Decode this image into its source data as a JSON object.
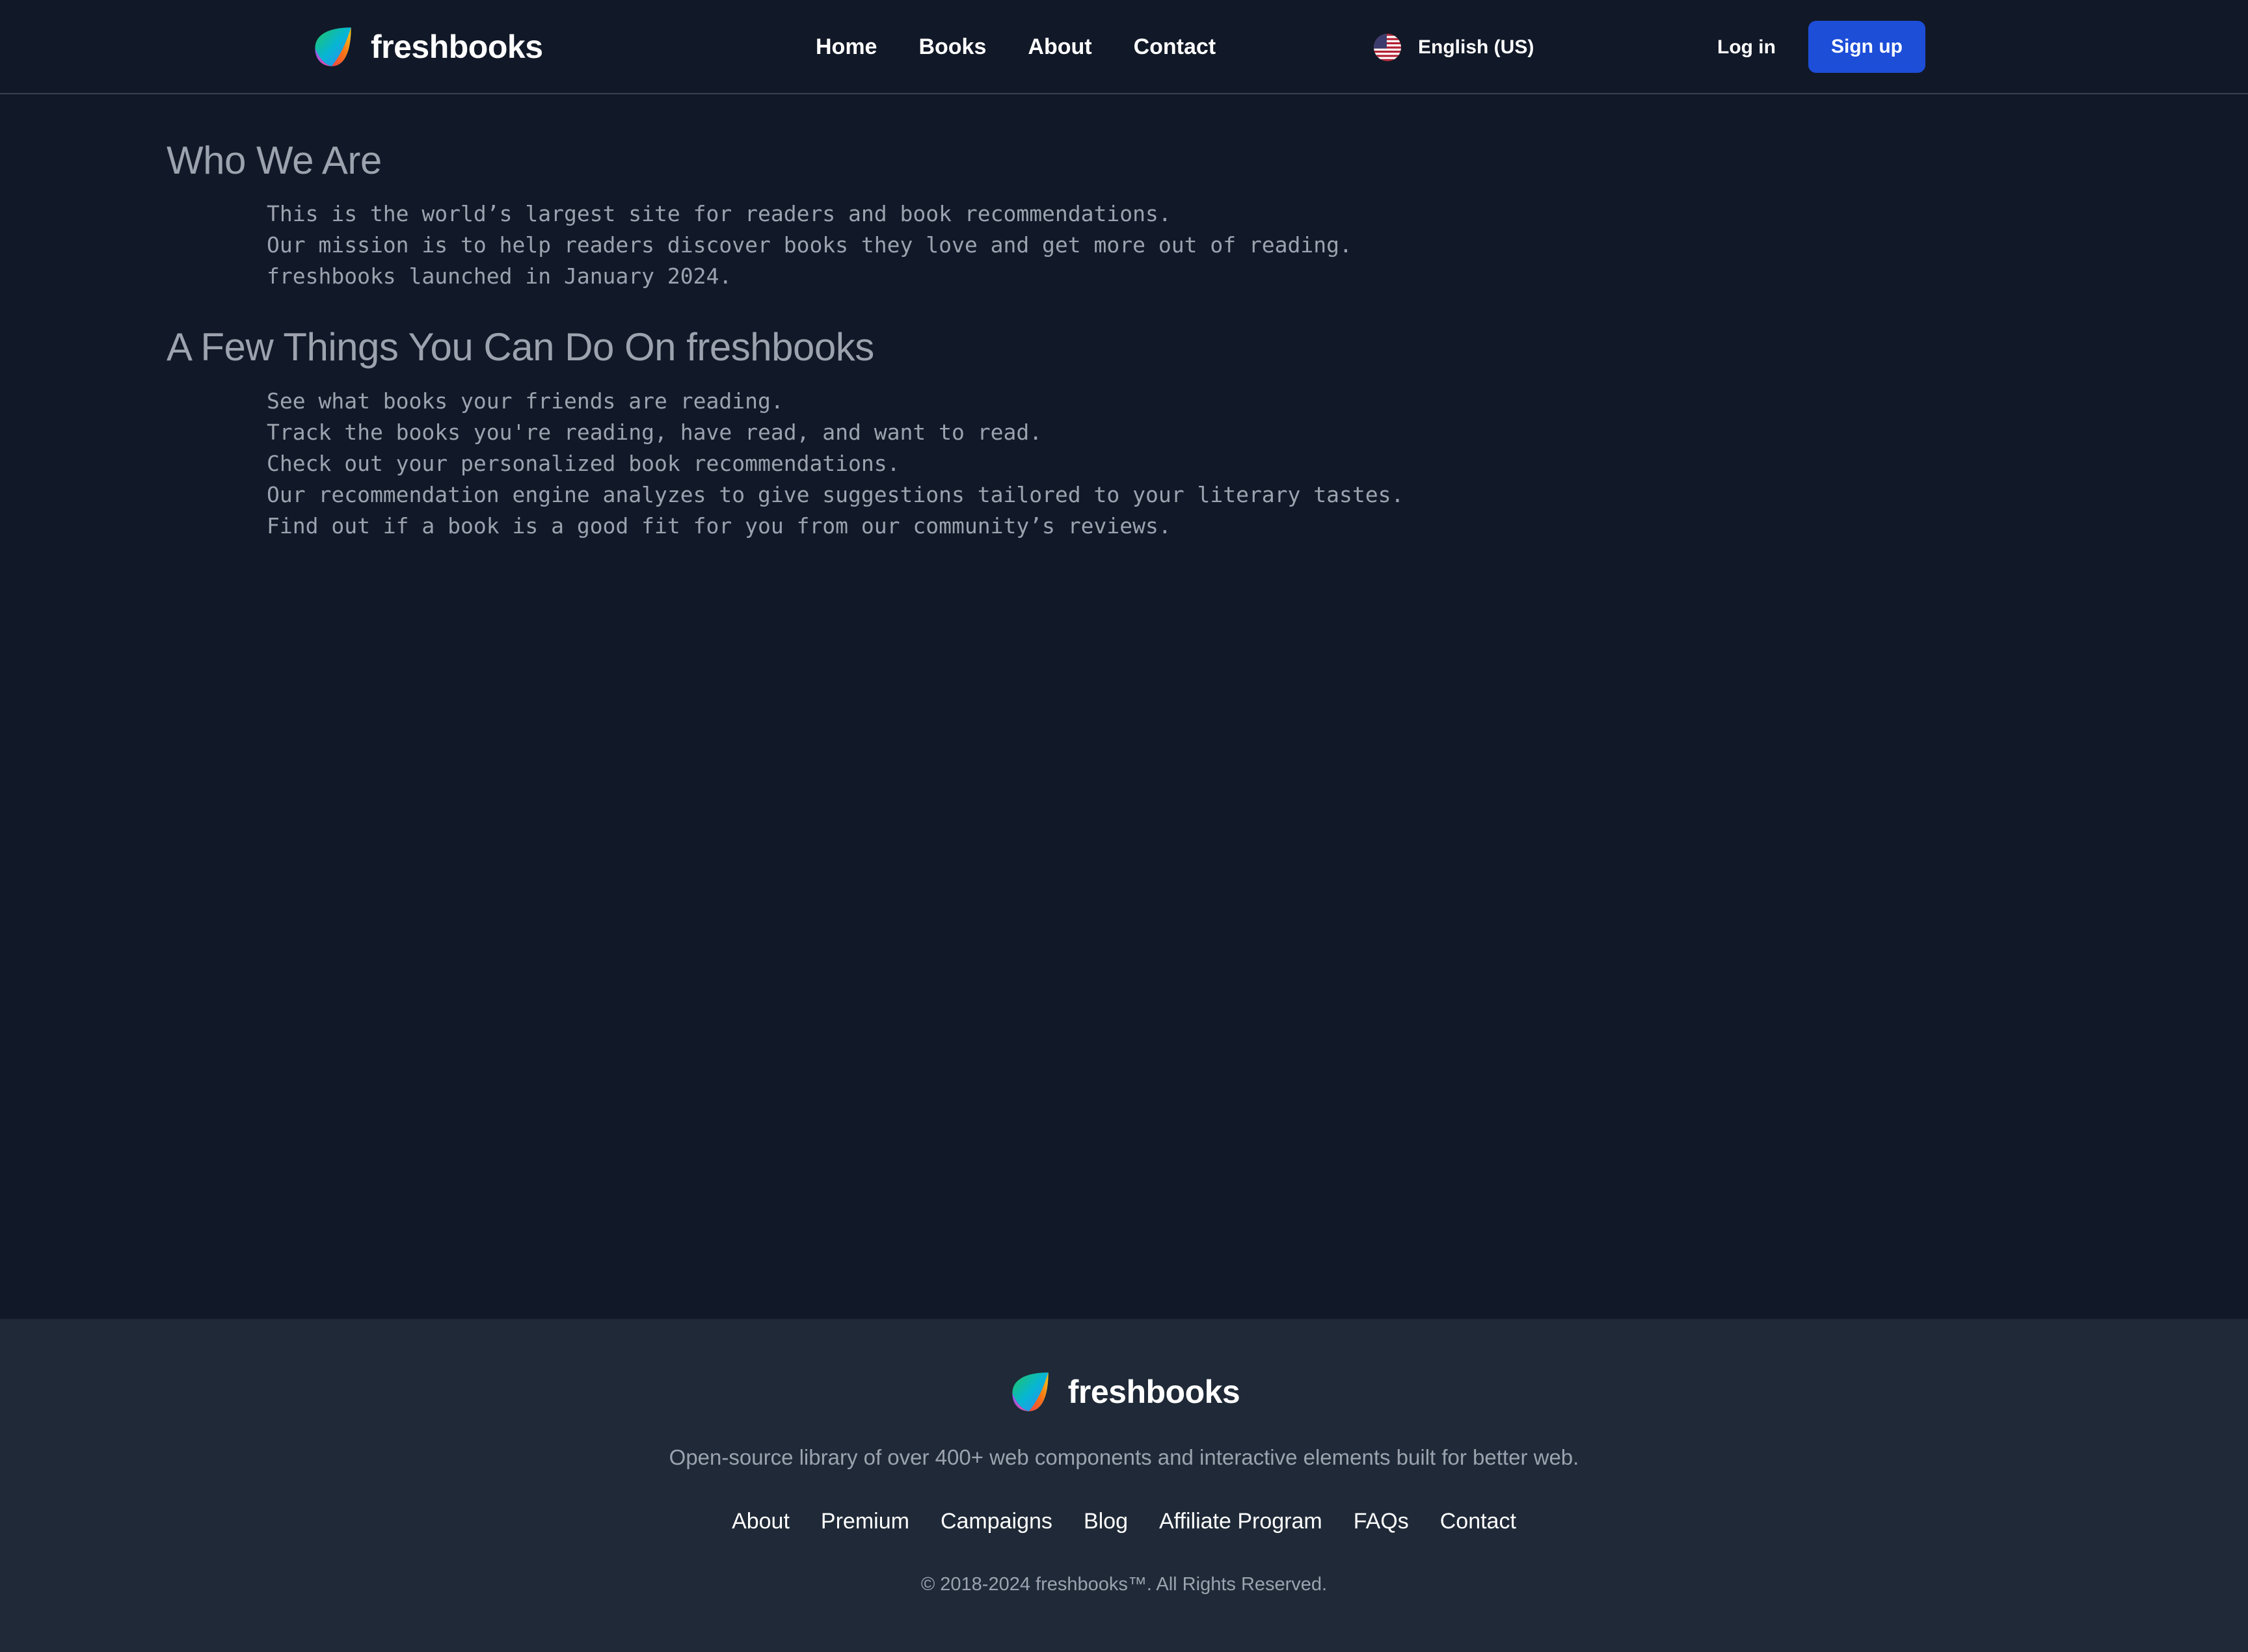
{
  "header": {
    "brand_name": "freshbooks",
    "nav": [
      {
        "label": "Home"
      },
      {
        "label": "Books"
      },
      {
        "label": "About"
      },
      {
        "label": "Contact"
      }
    ],
    "language": {
      "label": "English (US)",
      "flag_icon": "us-flag-icon"
    },
    "login_label": "Log in",
    "signup_label": "Sign up"
  },
  "main": {
    "sections": [
      {
        "title": "Who We Are",
        "lines": [
          "This is the world’s largest site for readers and book recommendations.",
          "Our mission is to help readers discover books they love and get more out of reading.",
          "freshbooks launched in January 2024."
        ]
      },
      {
        "title": "A Few Things You Can Do On freshbooks",
        "lines": [
          "See what books your friends are reading.",
          "Track the books you're reading, have read, and want to read.",
          "Check out your personalized book recommendations.",
          "Our recommendation engine analyzes to give suggestions tailored to your literary tastes.",
          "Find out if a book is a good fit for you from our community’s reviews."
        ]
      }
    ]
  },
  "footer": {
    "brand_name": "freshbooks",
    "tagline": "Open-source library of over 400+ web components and interactive elements built for better web.",
    "links": [
      {
        "label": "About"
      },
      {
        "label": "Premium"
      },
      {
        "label": "Campaigns"
      },
      {
        "label": "Blog"
      },
      {
        "label": "Affiliate Program"
      },
      {
        "label": "FAQs"
      },
      {
        "label": "Contact"
      }
    ],
    "copyright": "© 2018-2024 freshbooks™. All Rights Reserved."
  },
  "colors": {
    "page_background": "#111827",
    "footer_background": "#1f2937",
    "accent_button": "#1d4ed8",
    "muted_text": "#9ca3af",
    "divider": "#374151"
  }
}
